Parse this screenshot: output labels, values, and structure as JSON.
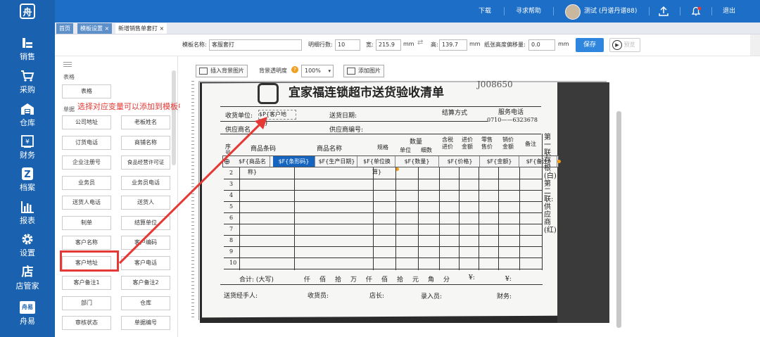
{
  "topbar": {
    "download": "下载",
    "help": "寻求帮助",
    "user": "测试 (丹谱丹谱88)",
    "logout": "退出"
  },
  "sidebar": {
    "items": [
      {
        "label": "销售",
        "icon": "sales-icon"
      },
      {
        "label": "采购",
        "icon": "cart-icon"
      },
      {
        "label": "仓库",
        "icon": "warehouse-icon"
      },
      {
        "label": "财务",
        "icon": "finance-icon"
      },
      {
        "label": "档案",
        "icon": "archive-icon"
      },
      {
        "label": "报表",
        "icon": "report-icon"
      },
      {
        "label": "设置",
        "icon": "gear-icon"
      },
      {
        "label": "店管家",
        "icon": "store-icon"
      },
      {
        "label": "舟易",
        "icon": "brand-icon"
      }
    ],
    "store_glyph": "店",
    "brand_glyph": "舟易"
  },
  "tabs": [
    {
      "label": "首页",
      "closable": false
    },
    {
      "label": "模板设置",
      "closable": true
    },
    {
      "label": "新增销售单套打",
      "closable": true
    }
  ],
  "toolbar": {
    "template_name_label": "模板名称:",
    "template_name_value": "客服套打",
    "detail_rows_label": "明细行数:",
    "detail_rows_value": "10",
    "width_label": "宽:",
    "width_value": "215.9",
    "width_unit": "mm",
    "height_label": "高:",
    "height_value": "139.7",
    "height_unit": "mm",
    "paper_offset_label": "纸张高度偏移量:",
    "paper_offset_value": "0.0",
    "paper_offset_unit": "mm",
    "save_label": "保存",
    "preview_label": "预览"
  },
  "left_panel": {
    "section_table": "表格",
    "table_button": "表格",
    "section_single": "单据",
    "buttons": [
      [
        "公司地址",
        "老板姓名"
      ],
      [
        "订货电话",
        "商铺名称"
      ],
      [
        "企业注册号",
        "食品经营许可证"
      ],
      [
        "业务员",
        "业务员电话"
      ],
      [
        "送货人电话",
        "送货人"
      ],
      [
        "制单",
        "结算单位"
      ],
      [
        "客户名称",
        "客户编码"
      ],
      [
        "客户地址",
        "客户电话"
      ],
      [
        "客户备注1",
        "客户备注2"
      ],
      [
        "部门",
        "仓库"
      ],
      [
        "审核状态",
        "单据编号"
      ]
    ],
    "highlighted": "客户地址"
  },
  "canvas": {
    "insert_bg_label": "插入背景图片",
    "bg_opacity_label": "背景透明度",
    "bg_opacity_value": "100%",
    "add_image_label": "添加图片",
    "annotation": "选择对应变量可以添加到模板中"
  },
  "paper": {
    "title": "宜家福连锁超市送货验收清单",
    "serial": "J008650",
    "receiver_label": "收货单位:",
    "receiver_var": "$P{客户地址}",
    "delivery_date_label": "送货日期:",
    "settle_label": "结算方式",
    "service_phone_label": "服务电话",
    "service_phone": "0710——6323678",
    "supplier_name_label": "供应商名",
    "supplier_code_label": "供应商编号:",
    "headers": {
      "seq": "序号",
      "barcode": "商品条码",
      "name": "商品名称",
      "spec": "规格",
      "qty": "数量",
      "unit": "单位",
      "pieces": "细数",
      "tax_price": "含税进价",
      "purchase_amount": "进价金额",
      "retail_price": "零售售价",
      "sale_amount": "销价金额",
      "remark": "备注"
    },
    "variables": [
      "$F{商品名称}",
      "$F{条形码}",
      "$F{生产日期}",
      "$F{单位换算}",
      "$F{数量}",
      "$F{价格}",
      "$F{金额}",
      "$F{备注}"
    ],
    "row_numbers": [
      "2",
      "3",
      "4",
      "5",
      "6",
      "7",
      "8",
      "9",
      "10"
    ],
    "total_label": "合计:  (大写)",
    "total_units": "仟　佰　拾　万　仟　佰　拾　元　角　分",
    "currency": "¥:",
    "currency2": "¥:",
    "footer": {
      "deliverer": "送货经手人:",
      "receiver": "收货员:",
      "manager": "店长:",
      "entry": "录入员:",
      "finance": "财务:"
    },
    "side_note": "第一联存根(白) 第二联:供应商(红)"
  }
}
